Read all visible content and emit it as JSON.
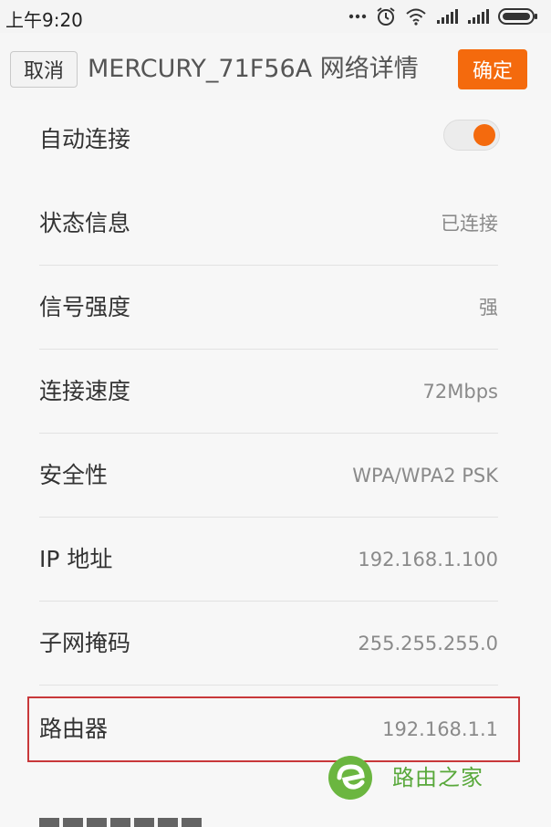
{
  "status_bar": {
    "time": "上午9:20",
    "icons": [
      "more-dots-icon",
      "alarm-icon",
      "wifi-icon",
      "signal-icon",
      "signal-icon",
      "battery-icon"
    ]
  },
  "header": {
    "cancel_label": "取消",
    "title": "MERCURY_71F56A 网络详情",
    "confirm_label": "确定"
  },
  "rows": [
    {
      "label": "自动连接",
      "toggle_on": true
    },
    {
      "label": "状态信息",
      "value": "已连接"
    },
    {
      "label": "信号强度",
      "value": "强"
    },
    {
      "label": "连接速度",
      "value": "72Mbps"
    },
    {
      "label": "安全性",
      "value": "WPA/WPA2 PSK"
    },
    {
      "label": "IP 地址",
      "value": "192.168.1.100"
    },
    {
      "label": "子网掩码",
      "value": "255.255.255.0"
    },
    {
      "label": "路由器",
      "value": "192.168.1.1"
    }
  ],
  "watermark": {
    "text": "路由之家"
  },
  "colors": {
    "accent": "#f46a0d",
    "highlight": "#c8383a",
    "watermark": "#58a83a"
  }
}
